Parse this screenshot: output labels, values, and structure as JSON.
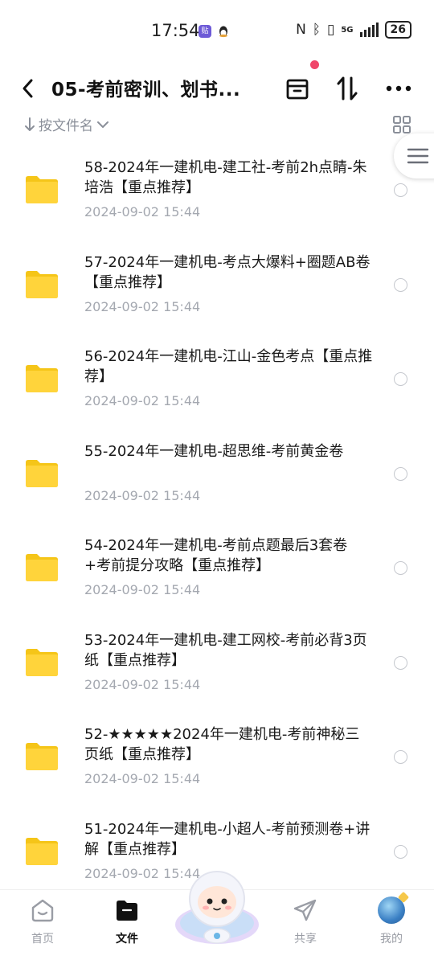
{
  "status_bar": {
    "time": "17:54",
    "app_badge": "贴",
    "network": "5G",
    "battery": "26"
  },
  "header": {
    "title": "05-考前密训、划书..."
  },
  "sort_bar": {
    "label": "按文件名"
  },
  "files": [
    {
      "name": "58-2024年一建机电-建工社-考前2h点睛-朱培浩【重点推荐】",
      "date": "2024-09-02  15:44"
    },
    {
      "name": "57-2024年一建机电-考点大爆料+圈题AB卷【重点推荐】",
      "date": "2024-09-02  15:44"
    },
    {
      "name": "56-2024年一建机电-江山-金色考点【重点推荐】",
      "date": "2024-09-02  15:44"
    },
    {
      "name": "55-2024年一建机电-超思维-考前黄金卷",
      "date": "2024-09-02  15:44"
    },
    {
      "name": "54-2024年一建机电-考前点题最后3套卷+考前提分攻略【重点推荐】",
      "date": "2024-09-02  15:44"
    },
    {
      "name": "53-2024年一建机电-建工网校-考前必背3页纸【重点推荐】",
      "date": "2024-09-02  15:44"
    },
    {
      "name": "52-★★★★★2024年一建机电-考前神秘三页纸【重点推荐】",
      "date": "2024-09-02  15:44"
    },
    {
      "name": "51-2024年一建机电-小超人-考前预测卷+讲解【重点推荐】",
      "date": "2024-09-02  15:44"
    }
  ],
  "bottom_nav": {
    "home": "首页",
    "files": "文件",
    "share": "共享",
    "mine": "我的"
  },
  "colors": {
    "folder": "#FFD43B",
    "folder_tab": "#F5C518",
    "accent_dot": "#F0466A",
    "muted_text": "#A4A8B0"
  }
}
